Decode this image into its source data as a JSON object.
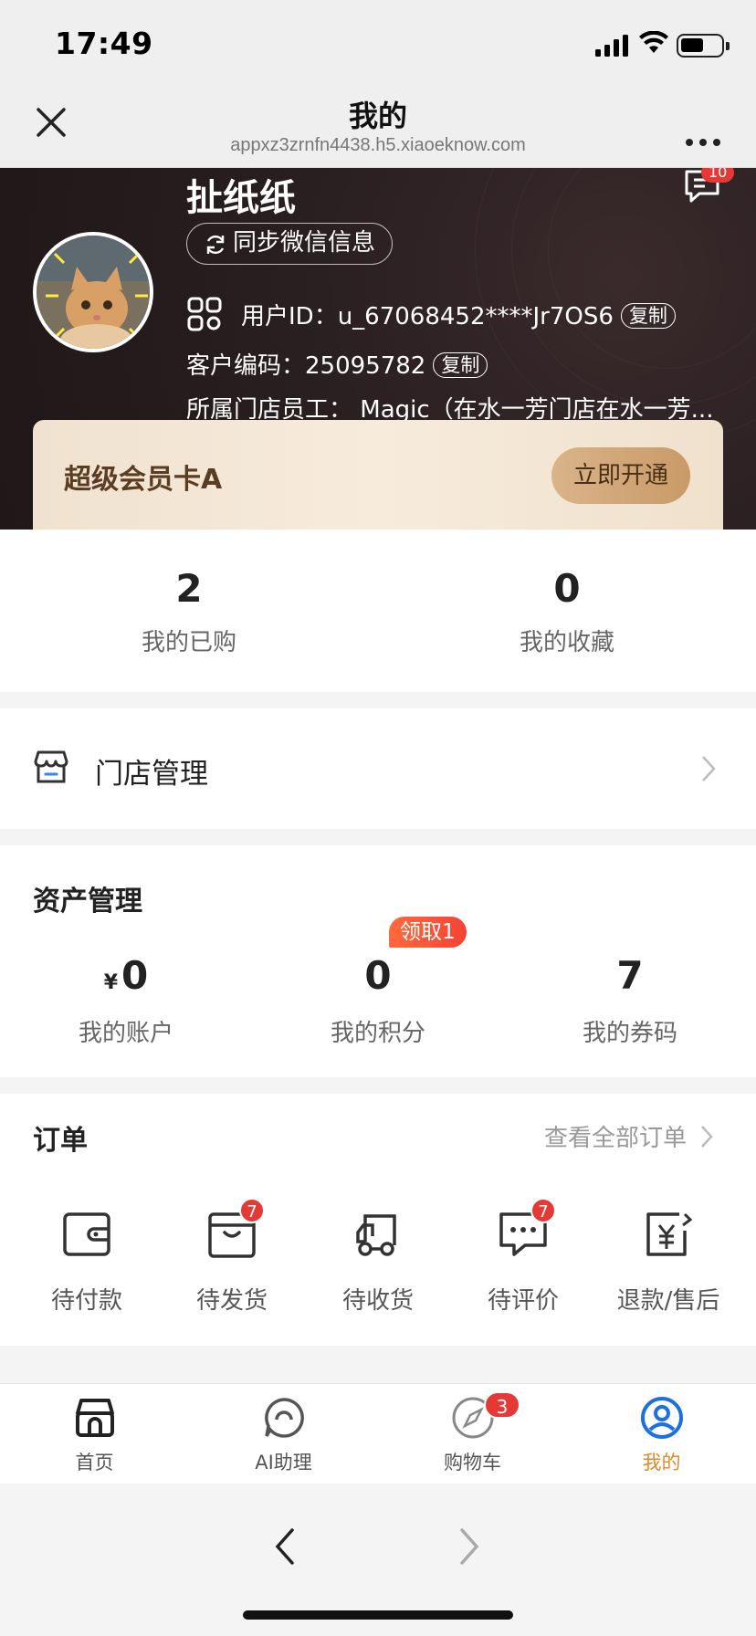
{
  "status": {
    "time": "17:49"
  },
  "browser": {
    "title": "我的",
    "url": "appxz3zrnfn4438.h5.xiaoeknow.com"
  },
  "profile": {
    "name": "扯纸纸",
    "sync_label": "同步微信信息",
    "message_count": "10",
    "user_id_label": "用户ID：",
    "user_id": "u_67068452****Jr7OS6",
    "copy_label": "复制",
    "customer_code_label": "客户编码：",
    "customer_code": "25095782",
    "staff_label": "所属门店员工：",
    "staff_value": "Magic（在水一芳门店在水一芳..."
  },
  "vip": {
    "title": "超级会员卡A",
    "button": "立即开通"
  },
  "stats": [
    {
      "value": "2",
      "label": "我的已购"
    },
    {
      "value": "0",
      "label": "我的收藏"
    }
  ],
  "store": {
    "label": "门店管理"
  },
  "assets": {
    "title": "资产管理",
    "badge": "领取1",
    "currency": "¥",
    "items": [
      {
        "value": "0",
        "label": "我的账户"
      },
      {
        "value": "0",
        "label": "我的积分"
      },
      {
        "value": "7",
        "label": "我的券码"
      }
    ]
  },
  "orders": {
    "title": "订单",
    "view_all": "查看全部订单",
    "items": [
      {
        "label": "待付款",
        "icon": "wallet-icon",
        "badge": ""
      },
      {
        "label": "待发货",
        "icon": "package-icon",
        "badge": "7"
      },
      {
        "label": "待收货",
        "icon": "truck-icon",
        "badge": ""
      },
      {
        "label": "待评价",
        "icon": "comment-icon",
        "badge": "7"
      },
      {
        "label": "退款/售后",
        "icon": "refund-icon",
        "badge": ""
      }
    ]
  },
  "tabbar": {
    "items": [
      {
        "label": "首页",
        "icon": "store-icon"
      },
      {
        "label": "AI助理",
        "icon": "chat-bubble-icon"
      },
      {
        "label": "购物车",
        "icon": "compass-icon",
        "badge": "3"
      },
      {
        "label": "我的",
        "icon": "user-icon",
        "active": true
      }
    ]
  },
  "colors": {
    "accent": "#e08a2a",
    "badge": "#e53935",
    "header_bg": "#231a1b",
    "vip_button": "#d1a676"
  }
}
